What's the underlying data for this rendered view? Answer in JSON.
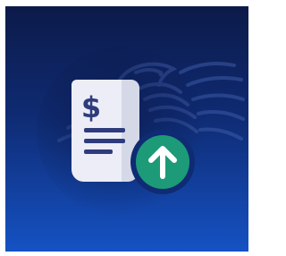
{
  "app_icon": {
    "symbol": "$",
    "document_icon": "invoice-document-icon",
    "badge_icon": "upload-arrow-icon",
    "watermark_icon": "eagle-watermark-icon",
    "colors": {
      "background_top": "#0c1a49",
      "background_bottom": "#1552c4",
      "document_face": "#ecedf6",
      "document_fold": "#d5d8e6",
      "document_ink": "#2f3c7c",
      "badge_ring": "#0f2b73",
      "badge_fill": "#1d9a78",
      "arrow": "#ffffff"
    }
  }
}
